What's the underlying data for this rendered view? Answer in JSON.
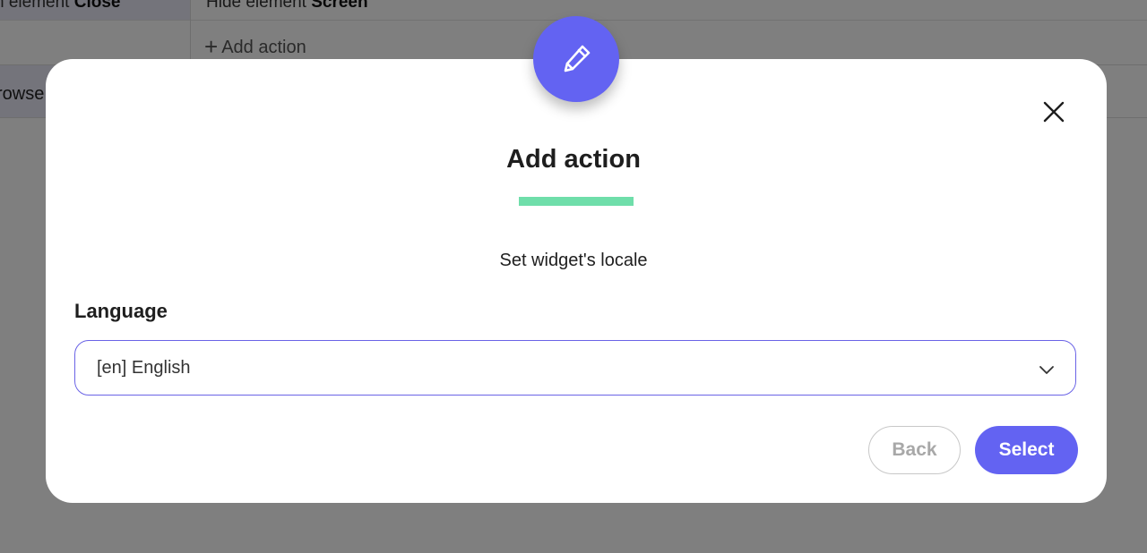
{
  "background": {
    "row1_left_prefix": "n element",
    "row1_left_bold": "Close",
    "row1_right_prefix": "Hide element",
    "row1_right_bold": "Screen",
    "add_action_label": "Add action",
    "row3_label": "rowse"
  },
  "modal": {
    "icon": "pencil-icon",
    "title": "Add action",
    "subtitle": "Set widget's locale",
    "field_label": "Language",
    "select": {
      "value": "[en] English"
    },
    "buttons": {
      "back": "Back",
      "select": "Select"
    },
    "close_icon": "close-icon"
  },
  "colors": {
    "accent": "#6363f2",
    "underline": "#6fdeaa",
    "overlay": "rgba(0,0,0,0.5)"
  }
}
